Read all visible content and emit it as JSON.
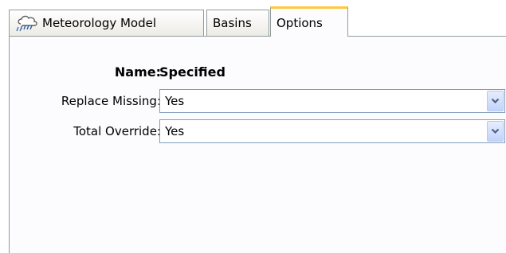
{
  "tabs": [
    {
      "label": "Meteorology Model",
      "icon": "weather-cloud-icon"
    },
    {
      "label": "Basins"
    },
    {
      "label": "Options",
      "selected": true
    }
  ],
  "form": {
    "name_label": "Name:",
    "name_value": "Specified",
    "replace_missing_label": "Replace Missing:",
    "replace_missing_value": "Yes",
    "total_override_label": "Total Override:",
    "total_override_value": "Yes"
  },
  "colors": {
    "active_tab_accent": "#ffc83c",
    "border": "#919b9c",
    "combo_border": "#7f9db9"
  }
}
